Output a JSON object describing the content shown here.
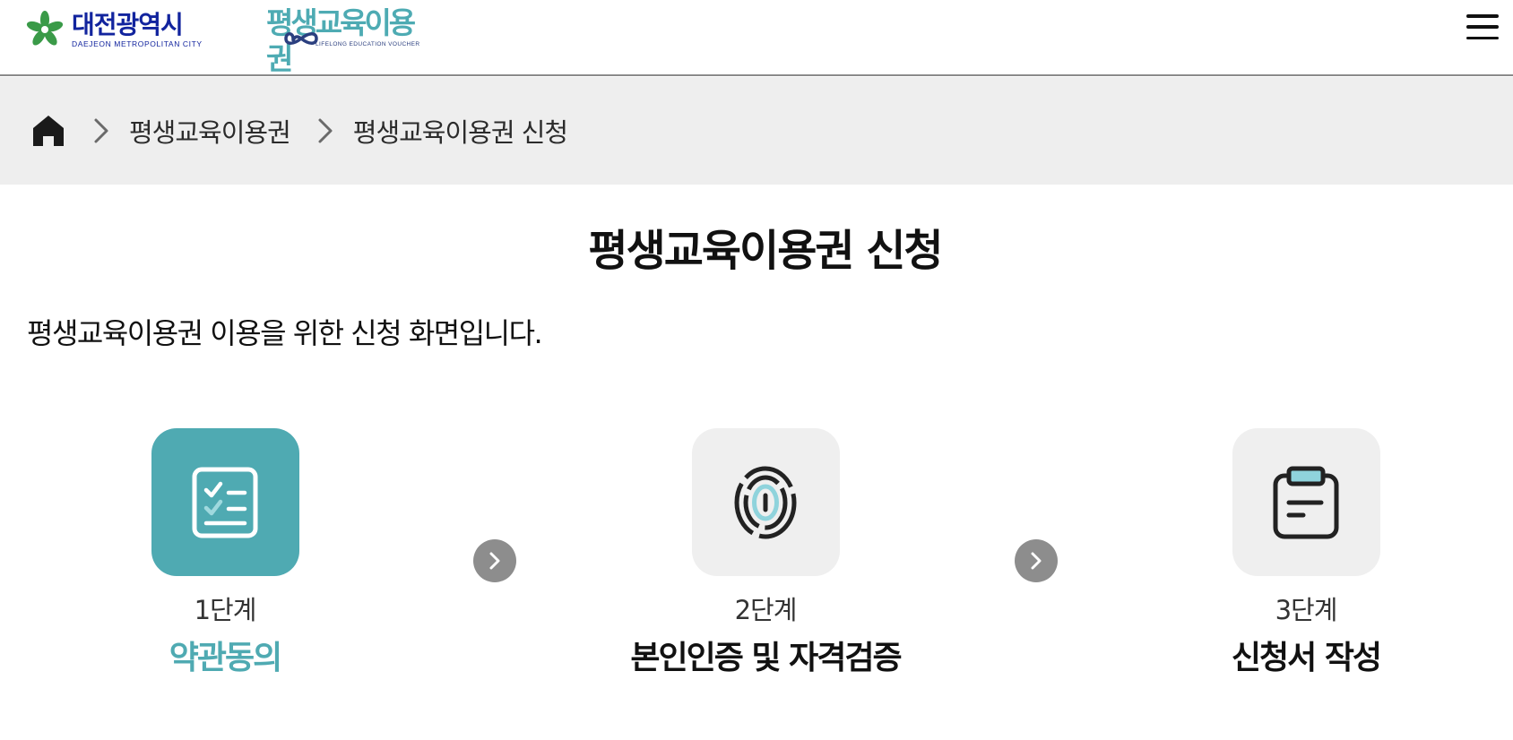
{
  "header": {
    "city_logo_name": "대전광역시",
    "city_logo_sub": "DAEJEON METROPOLITAN CITY",
    "voucher_logo_title": "평생교육이용권",
    "voucher_logo_sub": "LIFELONG EDUCATION VOUCHER",
    "menu_icon": "hamburger-menu-icon"
  },
  "breadcrumb": {
    "home_icon": "home-icon",
    "separator_icon": "chevron-right-icon",
    "items": [
      "평생교육이용권",
      "평생교육이용권 신청"
    ]
  },
  "main": {
    "title": "평생교육이용권 신청",
    "description": "평생교육이용권 이용을 위한 신청 화면입니다."
  },
  "steps": [
    {
      "number": "1단계",
      "label": "약관동의",
      "icon": "checklist-icon",
      "active": true
    },
    {
      "number": "2단계",
      "label": "본인인증 및 자격검증",
      "icon": "fingerprint-icon",
      "active": false
    },
    {
      "number": "3단계",
      "label": "신청서 작성",
      "icon": "clipboard-icon",
      "active": false
    }
  ],
  "colors": {
    "accent": "#4faab2",
    "city_blue": "#12249e",
    "logo_green": "#3a9a48",
    "breadcrumb_bg": "#eeeeee",
    "step_inactive_bg": "#efefef",
    "arrow_bg": "#8d8d8d"
  }
}
